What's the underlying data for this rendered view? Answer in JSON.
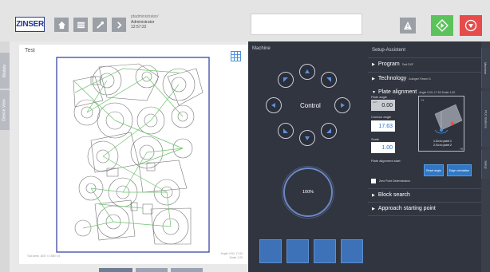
{
  "header": {
    "logo_text": "ZINSER",
    "user_line1": "pfadministrator/",
    "user_line2": "Administrator",
    "time": "12:57:22"
  },
  "left_tabs": [
    "Module",
    "Device View"
  ],
  "canvas": {
    "title": "Test",
    "info_left": "Tool area: 1647 x 1560 x 5",
    "info_right_1": "Angle 0.00; 17.63",
    "info_right_2": "Scale 1.00"
  },
  "machine": {
    "title": "Machine",
    "control_label": "Control",
    "progress": "100%"
  },
  "setup": {
    "title": "Setup-Assistent",
    "program_label": "Program",
    "program_value": "Test.DXF",
    "technology_label": "Technology",
    "technology_value": "Autogen Fasen t1",
    "plate_alignment_label": "Plate alignment",
    "plate_alignment_sub": "Angle 0.00; 17.63 Scale 1.00",
    "plate_angle_label": "Plate angle",
    "plate_angle_value": "0.00",
    "plate_angle_prefix": "ACT",
    "contour_angle_label": "Contour angle",
    "contour_angle_value": "17.63",
    "scale_label": "Scale",
    "scale_value": "1.00",
    "go_point_1": "1.Go to point 1",
    "go_point_2": "2.Go to point 2",
    "start_label": "Plate alignment start:",
    "reset_angle": "Reset angle",
    "edge_orientation": "Edge orientation",
    "zero_point_label": "Zero Point Determination",
    "block_search": "Block search",
    "approach": "Approach starting point"
  },
  "right_tabs": [
    "Machine",
    "PLC Buttons",
    "Setup"
  ]
}
